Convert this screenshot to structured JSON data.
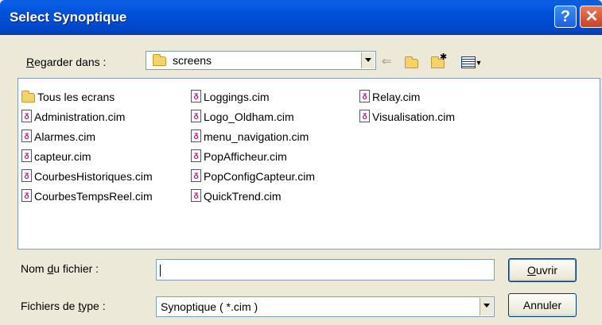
{
  "window": {
    "title": "Select Synoptique"
  },
  "lookin": {
    "label_prefix": "",
    "label_ul": "R",
    "label_rest": "egarder dans :",
    "value": "screens"
  },
  "toolbar": {
    "back": "back-arrow-icon",
    "up": "up-folder-icon",
    "newfolder": "new-folder-icon",
    "view": "view-menu-icon"
  },
  "files": {
    "col1": [
      "Tous les ecrans",
      "Administration.cim",
      "Alarmes.cim",
      "capteur.cim",
      "CourbesHistoriques.cim",
      "CourbesTempsReel.cim"
    ],
    "col2": [
      "Loggings.cim",
      "Logo_Oldham.cim",
      "menu_navigation.cim",
      "PopAfficheur.cim",
      "PopConfigCapteur.cim",
      "QuickTrend.cim"
    ],
    "col3": [
      "Relay.cim",
      "Visualisation.cim"
    ]
  },
  "filename": {
    "label_pre": "Nom ",
    "label_ul": "d",
    "label_post": "u fichier :",
    "value": ""
  },
  "filetype": {
    "label_pre": "Fichiers de ",
    "label_ul": "t",
    "label_post": "ype :",
    "value": "Synoptique ( *.cim )"
  },
  "buttons": {
    "open_ul": "O",
    "open_rest": "uvrir",
    "cancel": "Annuler"
  }
}
